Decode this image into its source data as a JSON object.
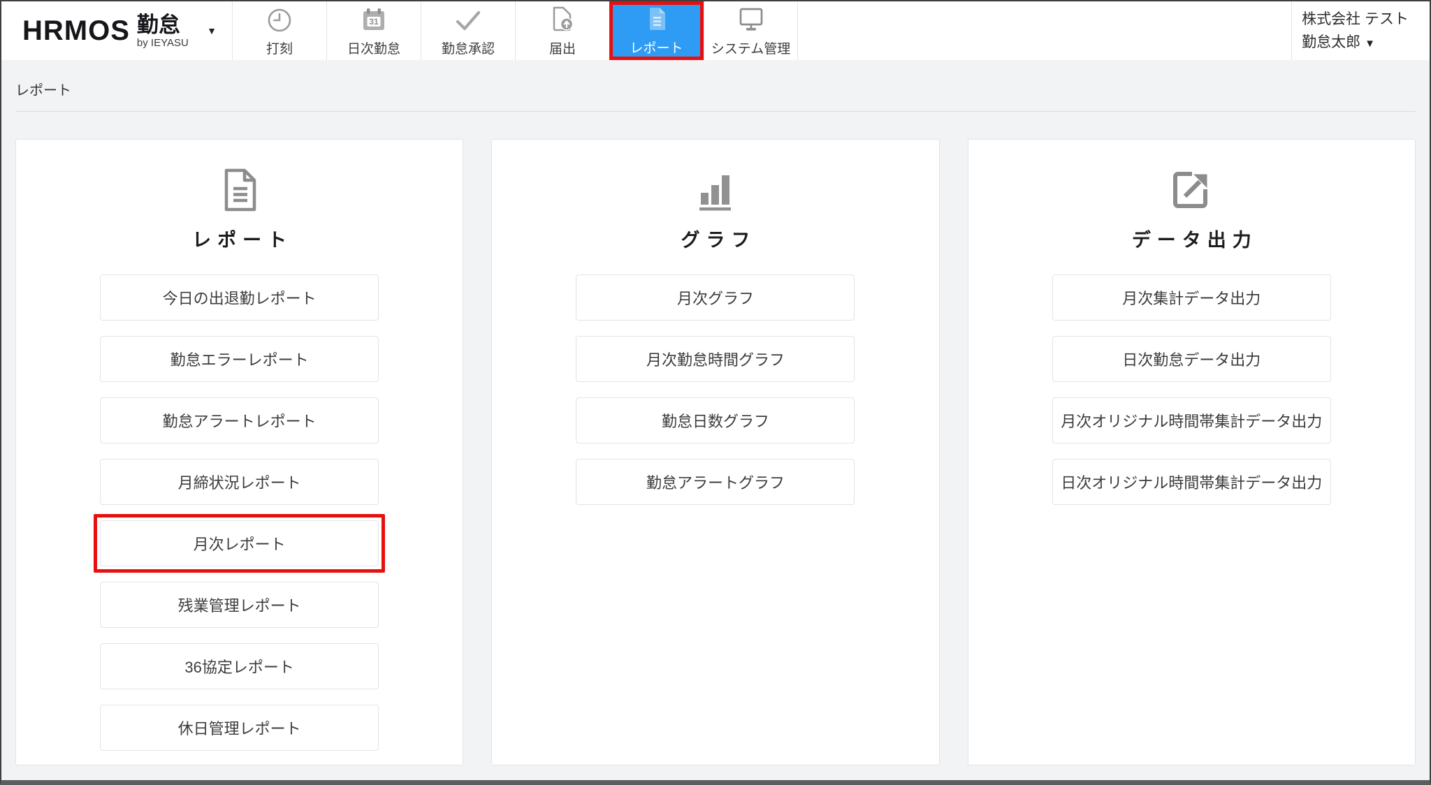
{
  "colors": {
    "active_tab_bg": "#2e9cf4",
    "annotation_red": "#e8100f",
    "icon_gray": "#8e8e8e",
    "page_bg": "#f2f3f5"
  },
  "header": {
    "logo": {
      "brand": "HRMOS",
      "product": "勤怠",
      "byline": "by IEYASU",
      "dropdown_icon": "caret-down-icon"
    },
    "tabs": [
      {
        "id": "punch",
        "label": "打刻",
        "icon": "clock-icon",
        "active": false
      },
      {
        "id": "daily",
        "label": "日次勤怠",
        "icon": "calendar-31-icon",
        "active": false
      },
      {
        "id": "approval",
        "label": "勤怠承認",
        "icon": "check-icon",
        "active": false
      },
      {
        "id": "application",
        "label": "届出",
        "icon": "document-upload-icon",
        "active": false
      },
      {
        "id": "report",
        "label": "レポート",
        "icon": "report-page-icon",
        "active": true,
        "annotated": true
      },
      {
        "id": "system",
        "label": "システム管理",
        "icon": "monitor-icon",
        "active": false
      }
    ],
    "user": {
      "company": "株式会社 テスト",
      "name": "勤怠太郎",
      "dropdown_icon": "caret-down-icon"
    }
  },
  "breadcrumb": {
    "label": "レポート"
  },
  "cards": [
    {
      "id": "report",
      "title": "レポート",
      "icon": "report-document-icon",
      "buttons": [
        {
          "label": "今日の出退勤レポート"
        },
        {
          "label": "勤怠エラーレポート"
        },
        {
          "label": "勤怠アラートレポート"
        },
        {
          "label": "月締状況レポート"
        },
        {
          "label": "月次レポート",
          "annotated": true
        },
        {
          "label": "残業管理レポート"
        },
        {
          "label": "36協定レポート"
        },
        {
          "label": "休日管理レポート"
        }
      ]
    },
    {
      "id": "graph",
      "title": "グラフ",
      "icon": "bar-chart-icon",
      "buttons": [
        {
          "label": "月次グラフ"
        },
        {
          "label": "月次勤怠時間グラフ"
        },
        {
          "label": "勤怠日数グラフ"
        },
        {
          "label": "勤怠アラートグラフ"
        }
      ]
    },
    {
      "id": "data-export",
      "title": "データ出力",
      "icon": "export-icon",
      "buttons": [
        {
          "label": "月次集計データ出力"
        },
        {
          "label": "日次勤怠データ出力"
        },
        {
          "label": "月次オリジナル時間帯集計データ出力"
        },
        {
          "label": "日次オリジナル時間帯集計データ出力"
        }
      ]
    }
  ]
}
